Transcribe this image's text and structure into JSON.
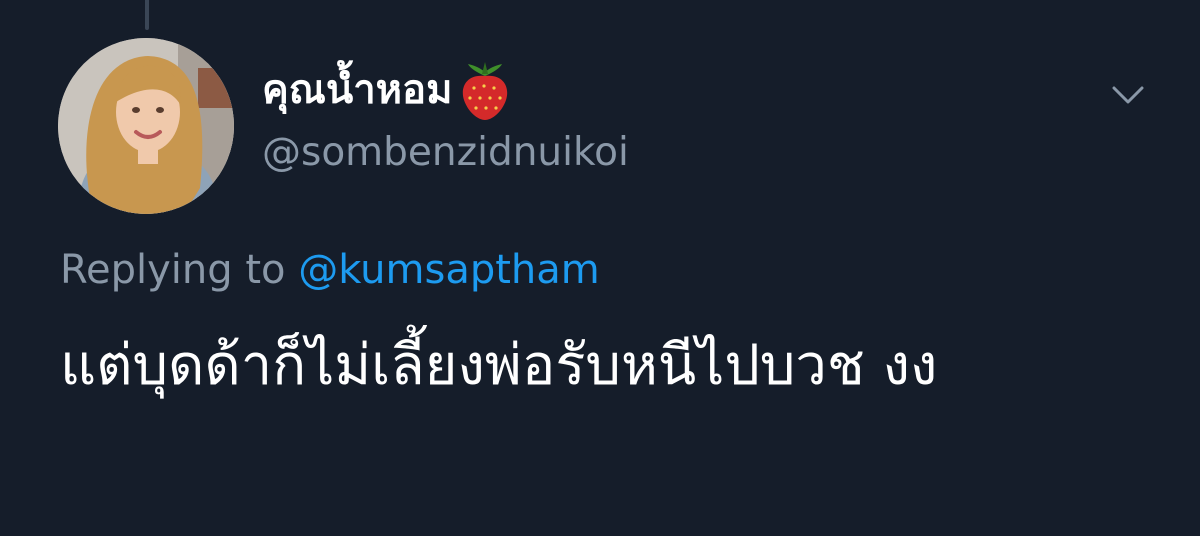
{
  "tweet": {
    "display_name": "คุณน้ำหอม",
    "name_emoji_icon": "strawberry-emoji",
    "handle": "@sombenzidnuikoi",
    "reply_prefix": "Replying to",
    "reply_mention": "@kumsaptham",
    "text": "แต่บุดด้าก็ไม่เลี้ยงพ่อรับหนีไปบวช งง"
  },
  "colors": {
    "background": "#151d2a",
    "text_primary": "#ffffff",
    "text_secondary": "#8a98a8",
    "link": "#1d9bf0"
  },
  "icons": {
    "menu": "chevron-down-icon"
  }
}
